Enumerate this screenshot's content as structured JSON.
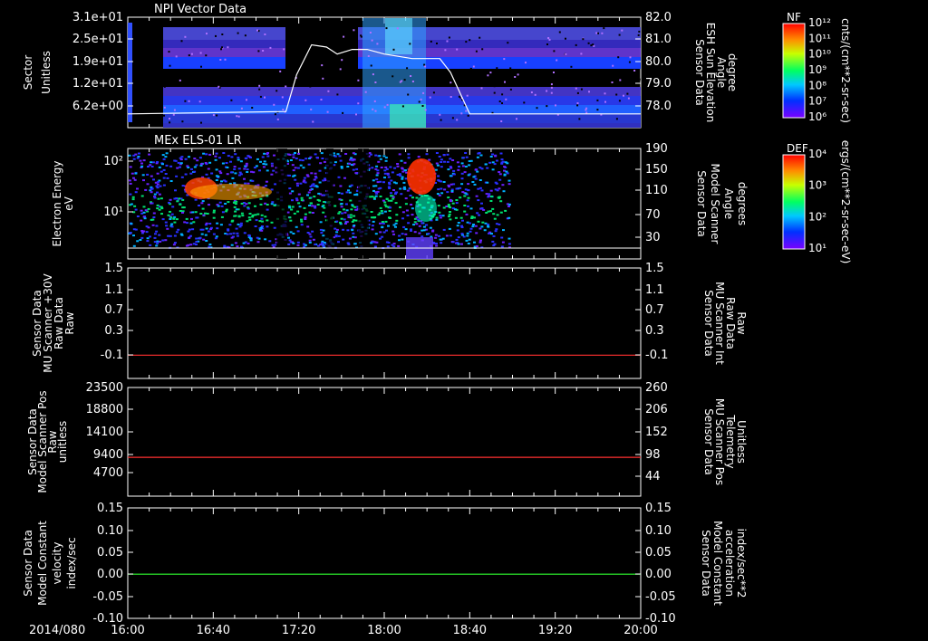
{
  "chart_data": {
    "type": "multi-panel time series",
    "x_axis": {
      "prefix": "2014/080",
      "tick_labels": [
        "16:00",
        "16:40",
        "17:20",
        "18:00",
        "18:40",
        "19:20",
        "20:00"
      ]
    },
    "panels": [
      {
        "id": "p1",
        "type": "heatmap",
        "title": "NPI Vector Data",
        "ylabel_left": [
          "Sector",
          "Unitless"
        ],
        "ylabel_right": [
          "Sensor Data",
          "ESH Sun Elevation",
          "Angle",
          "degree"
        ],
        "yticks_left": [
          "3.1e+01",
          "2.5e+01",
          "1.9e+01",
          "1.2e+01",
          "6.2e+00"
        ],
        "yticks_right": [
          "82.0",
          "81.0",
          "80.0",
          "79.0",
          "78.0"
        ],
        "right_range": [
          77.2,
          82.0
        ],
        "overlay_line": {
          "name": "ESH Sun Elevation Angle",
          "t": [
            "16:00",
            "17:14",
            "17:19",
            "17:26",
            "17:33",
            "17:38",
            "17:45",
            "17:52",
            "18:00",
            "18:13",
            "18:26",
            "18:31",
            "18:40",
            "20:00"
          ],
          "values": [
            77.8,
            77.9,
            79.5,
            80.8,
            80.7,
            80.4,
            80.6,
            80.6,
            80.4,
            80.2,
            80.2,
            79.6,
            77.8,
            77.8
          ]
        },
        "colorbar": {
          "label": "NF",
          "units": "cnts/(cm**2-sr-sec)",
          "ticks": [
            "10¹²",
            "10¹¹",
            "10¹⁰",
            "10⁹",
            "10⁸",
            "10⁷",
            "10⁶"
          ]
        }
      },
      {
        "id": "p2",
        "type": "heatmap",
        "title": "MEx ELS-01 LR",
        "ylabel_left": [
          "Electron Energy",
          "eV"
        ],
        "ylabel_right": [
          "Sensor Data",
          "Model Scanner",
          "Angle",
          "degrees"
        ],
        "yticks_left": [
          "10²",
          "10¹"
        ],
        "yticks_right": [
          "190",
          "150",
          "110",
          "70",
          "30"
        ],
        "overlay_line": {
          "name": "Model Scanner Angle",
          "value": 10
        },
        "colorbar": {
          "label": "DEF",
          "units": "ergs/(cm**2-sr-sec-eV)",
          "ticks": [
            "10⁴",
            "10³",
            "10²",
            "10¹"
          ]
        }
      },
      {
        "id": "p3",
        "type": "line",
        "ylabel_left": [
          "Sensor Data",
          "MU Scanner +30V",
          "Raw Data",
          "Raw"
        ],
        "ylabel_right": [
          "Sensor Data",
          "MU Scanner Int",
          "Raw Data",
          "Raw"
        ],
        "yticks_left": [
          "1.5",
          "1.1",
          "0.7",
          "0.3",
          "-0.1"
        ],
        "yticks_right": [
          "1.5",
          "1.1",
          "0.7",
          "0.3",
          "-0.1"
        ],
        "ylim": [
          -0.4,
          1.5
        ],
        "series": [
          {
            "color": "#ff3030",
            "value": 0.0
          }
        ]
      },
      {
        "id": "p4",
        "type": "line",
        "ylabel_left": [
          "Sensor Data",
          "Model Scanner Pos",
          "Raw",
          "unitless"
        ],
        "ylabel_right": [
          "Sensor Data",
          "MU Scanner Pos",
          "Telemetry",
          "Unitless"
        ],
        "yticks_left": [
          "23500",
          "18800",
          "14100",
          "9400",
          "4700"
        ],
        "yticks_right": [
          "260",
          "206",
          "152",
          "98",
          "44"
        ],
        "ylim": [
          0,
          23500
        ],
        "series": [
          {
            "color": "#ff3030",
            "value": 8400
          }
        ]
      },
      {
        "id": "p5",
        "type": "line",
        "ylabel_left": [
          "Sensor Data",
          "Model Constant",
          "velocity",
          "index/sec"
        ],
        "ylabel_right": [
          "Sensor Data",
          "Model Constant",
          "acceleration",
          "index/sec**2"
        ],
        "yticks_left": [
          "0.15",
          "0.10",
          "0.05",
          "0.00",
          "-0.05",
          "-0.10"
        ],
        "yticks_right": [
          "0.15",
          "0.10",
          "0.05",
          "0.00",
          "-0.05",
          "-0.10"
        ],
        "ylim": [
          -0.1,
          0.15
        ],
        "series": [
          {
            "color": "#30ff30",
            "value": 0.0
          }
        ]
      }
    ]
  },
  "colors": {
    "background": "#000000",
    "foreground": "#ffffff",
    "red_axis": "#ff3030",
    "green_axis": "#30ff30"
  }
}
